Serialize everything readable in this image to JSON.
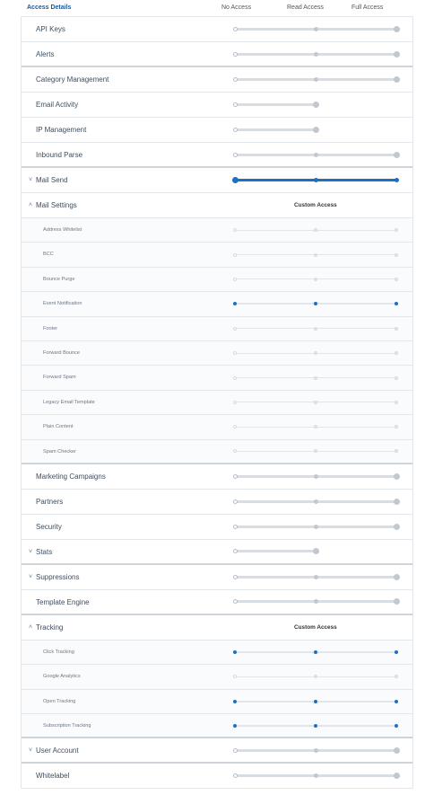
{
  "header": {
    "title": "Access Details",
    "no_access": "No Access",
    "read_access": "Read Access",
    "full_access": "Full Access"
  },
  "custom_access_label": "Custom Access",
  "rows": [
    {
      "label": "API Keys",
      "kind": "top",
      "level": 2,
      "max": 2
    },
    {
      "label": "Alerts",
      "kind": "top",
      "level": 2,
      "max": 2
    },
    {
      "label": "Category Management",
      "kind": "top",
      "level": 2,
      "max": 2,
      "sep_before": true
    },
    {
      "label": "Email Activity",
      "kind": "top",
      "level": 1,
      "max": 1
    },
    {
      "label": "IP Management",
      "kind": "top",
      "level": 1,
      "max": 1
    },
    {
      "label": "Inbound Parse",
      "kind": "top",
      "level": 2,
      "max": 2
    },
    {
      "label": "Mail Send",
      "kind": "top",
      "chevron": "down",
      "level": 2,
      "max": 2,
      "active": true,
      "sep_before": true
    },
    {
      "label": "Mail Settings",
      "kind": "section",
      "chevron": "up",
      "custom": true
    },
    {
      "label": "Address Whitelist",
      "kind": "sub",
      "level": 0,
      "max": 2
    },
    {
      "label": "BCC",
      "kind": "sub",
      "level": 0,
      "max": 2
    },
    {
      "label": "Bounce Purge",
      "kind": "sub",
      "level": 0,
      "max": 2
    },
    {
      "label": "Event Notification",
      "kind": "sub",
      "level": 2,
      "max": 2,
      "active": true
    },
    {
      "label": "Footer",
      "kind": "sub",
      "level": 0,
      "max": 2
    },
    {
      "label": "Forward Bounce",
      "kind": "sub",
      "level": 0,
      "max": 2
    },
    {
      "label": "Forward Spam",
      "kind": "sub",
      "level": 0,
      "max": 2
    },
    {
      "label": "Legacy Email Template",
      "kind": "sub",
      "level": 0,
      "max": 2
    },
    {
      "label": "Plain Content",
      "kind": "sub",
      "level": 0,
      "max": 2
    },
    {
      "label": "Spam Checker",
      "kind": "sub",
      "level": 0,
      "max": 2
    },
    {
      "label": "Marketing Campaigns",
      "kind": "top",
      "level": 2,
      "max": 2,
      "sep_before": true
    },
    {
      "label": "Partners",
      "kind": "top",
      "level": 2,
      "max": 2
    },
    {
      "label": "Security",
      "kind": "top",
      "level": 2,
      "max": 2
    },
    {
      "label": "Stats",
      "kind": "top",
      "chevron": "down",
      "level": 1,
      "max": 1
    },
    {
      "label": "Suppressions",
      "kind": "top",
      "chevron": "down",
      "level": 2,
      "max": 2,
      "sep_before": true
    },
    {
      "label": "Template Engine",
      "kind": "top",
      "level": 2,
      "max": 2
    },
    {
      "label": "Tracking",
      "kind": "section",
      "chevron": "up",
      "custom": true,
      "sep_before": true
    },
    {
      "label": "Click Tracking",
      "kind": "sub",
      "level": 2,
      "max": 2,
      "active": true
    },
    {
      "label": "Google Analytics",
      "kind": "sub",
      "level": 0,
      "max": 2
    },
    {
      "label": "Open Tracking",
      "kind": "sub",
      "level": 2,
      "max": 2,
      "active": true
    },
    {
      "label": "Subscription Tracking",
      "kind": "sub",
      "level": 2,
      "max": 2,
      "active": true
    },
    {
      "label": "User Account",
      "kind": "top",
      "chevron": "down",
      "level": 2,
      "max": 2,
      "sep_before": true
    },
    {
      "label": "Whitelabel",
      "kind": "top",
      "level": 2,
      "max": 2,
      "sep_before": true
    }
  ]
}
